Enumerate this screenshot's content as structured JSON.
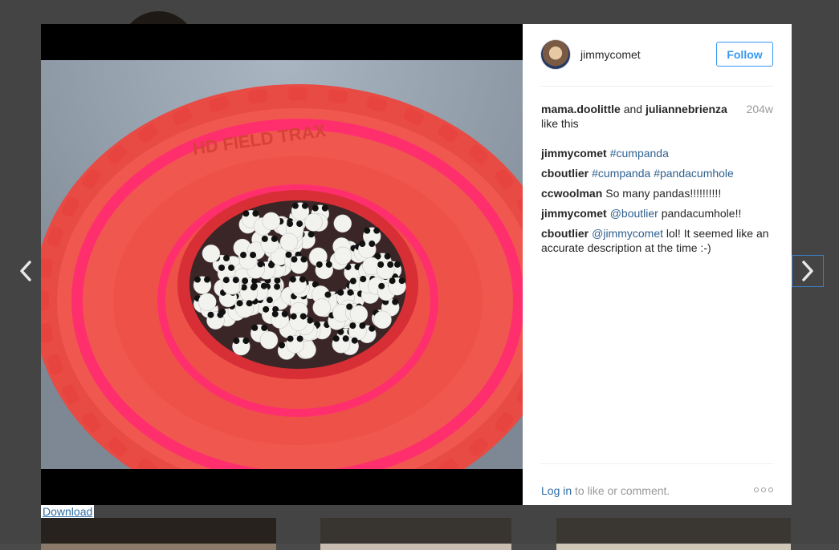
{
  "post": {
    "username": "jimmycomet",
    "follow_label": "Follow"
  },
  "likes": {
    "user1": "mama.doolittle",
    "and": "and",
    "user2": "juliannebrienza",
    "suffix": "like this",
    "age": "204w"
  },
  "comments": [
    {
      "user": "jimmycomet",
      "parts": [
        {
          "text": "#cumpanda",
          "tag": true
        }
      ]
    },
    {
      "user": "cboutlier",
      "parts": [
        {
          "text": "#cumpanda",
          "tag": true
        },
        {
          "text": " ",
          "tag": false
        },
        {
          "text": "#pandacumhole",
          "tag": true
        }
      ]
    },
    {
      "user": "ccwoolman",
      "parts": [
        {
          "text": "So many pandas!!!!!!!!!!",
          "tag": false
        }
      ]
    },
    {
      "user": "jimmycomet",
      "parts": [
        {
          "text": "@boutlier",
          "tag": true
        },
        {
          "text": " pandacumhole!!",
          "tag": false
        }
      ]
    },
    {
      "user": "cboutlier",
      "parts": [
        {
          "text": "@jimmycomet",
          "tag": true
        },
        {
          "text": " lol! It seemed like an accurate description at the time :-)",
          "tag": false
        }
      ]
    }
  ],
  "footer": {
    "login_link": "Log in",
    "login_suffix": " to like or comment."
  },
  "download_label": "Download",
  "tire_text": "HD FIELD TRAX",
  "colors": {
    "link": "#3897f0",
    "tag": "#2f5f8f",
    "tire": "#f0574f"
  },
  "icons": {
    "prev": "chevron-left-icon",
    "next": "chevron-right-icon",
    "more": "more-options-icon"
  }
}
